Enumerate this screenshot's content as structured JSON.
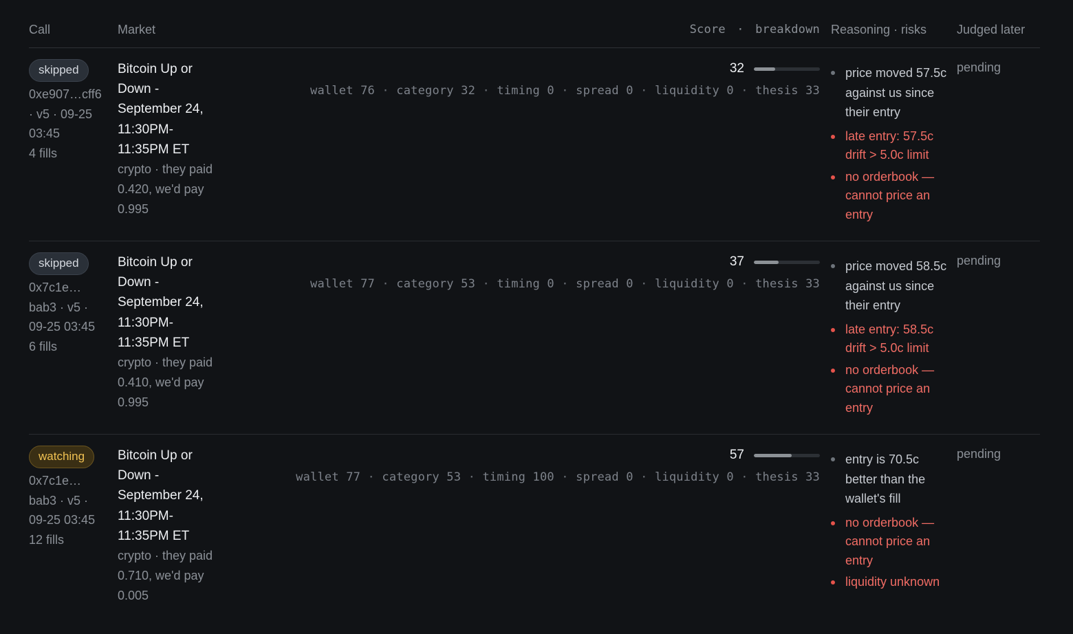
{
  "headers": {
    "call": "Call",
    "market": "Market",
    "score": "Score",
    "score_sep": "·",
    "breakdown": "breakdown",
    "reasoning": "Reasoning · risks",
    "judged": "Judged later"
  },
  "rows": [
    {
      "status": "skipped",
      "status_kind": "skipped",
      "wallet": "0xe907…cff6 · v5 · 09-25 03:45",
      "fills": "4 fills",
      "market_title": "Bitcoin Up or Down - September 24, 11:30PM-11:35PM ET",
      "market_sub": "crypto · they paid 0.420, we'd pay 0.995",
      "score": "32",
      "score_value": 32,
      "breakdown": "wallet 76 · category 32 · timing 0 · spread 0 · liquidity 0 · thesis 33",
      "notes": [
        "price moved 57.5c against us since their entry"
      ],
      "risks": [
        "late entry: 57.5c drift > 5.0c limit",
        "no orderbook — cannot price an entry"
      ],
      "judged": "pending"
    },
    {
      "status": "skipped",
      "status_kind": "skipped",
      "wallet": "0x7c1e… bab3 · v5 · 09-25 03:45",
      "fills": "6 fills",
      "market_title": "Bitcoin Up or Down - September 24, 11:30PM-11:35PM ET",
      "market_sub": "crypto · they paid 0.410, we'd pay 0.995",
      "score": "37",
      "score_value": 37,
      "breakdown": "wallet 77 · category 53 · timing 0 · spread 0 · liquidity 0 · thesis 33",
      "notes": [
        "price moved 58.5c against us since their entry"
      ],
      "risks": [
        "late entry: 58.5c drift > 5.0c limit",
        "no orderbook — cannot price an entry"
      ],
      "judged": "pending"
    },
    {
      "status": "watching",
      "status_kind": "watching",
      "wallet": "0x7c1e… bab3 · v5 · 09-25 03:45",
      "fills": "12 fills",
      "market_title": "Bitcoin Up or Down - September 24, 11:30PM-11:35PM ET",
      "market_sub": "crypto · they paid 0.710, we'd pay 0.005",
      "score": "57",
      "score_value": 57,
      "breakdown": "wallet 77 · category 53 · timing 100 · spread 0 · liquidity 0 · thesis 33",
      "notes": [
        "entry is 70.5c better than the wallet's fill"
      ],
      "risks": [
        "no orderbook — cannot price an entry",
        "liquidity unknown"
      ],
      "judged": "pending"
    }
  ],
  "colors": {
    "background": "#111316",
    "risk": "#f06c64",
    "watching": "#f0c152"
  }
}
